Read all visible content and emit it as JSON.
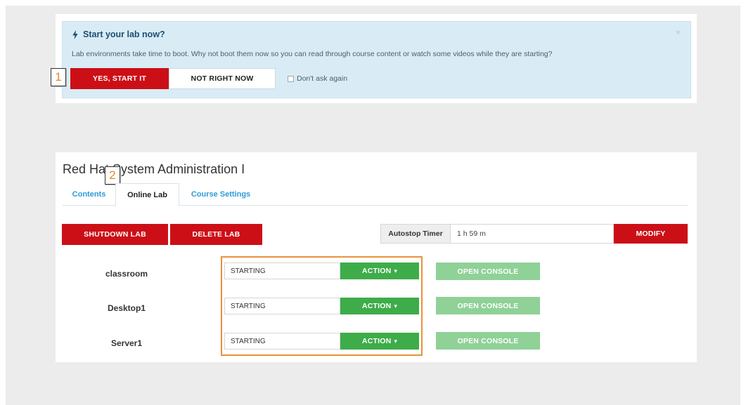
{
  "notice": {
    "title": "Start your lab now?",
    "close_symbol": "×",
    "message": "Lab environments take time to boot. Why not boot them now so you can read through course content or watch some videos while they are starting?",
    "yes_label": "YES, START IT",
    "no_label": "NOT RIGHT NOW",
    "dont_ask_label": "Don't ask again",
    "dont_ask_checked": false
  },
  "callouts": {
    "first": "1",
    "second": "2"
  },
  "lab": {
    "title": "Red Hat System Administration I",
    "tabs": [
      {
        "label": "Contents",
        "active": false
      },
      {
        "label": "Online Lab",
        "active": true
      },
      {
        "label": "Course Settings",
        "active": false
      }
    ],
    "shutdown_label": "SHUTDOWN LAB",
    "delete_label": "DELETE LAB",
    "autostop_label": "Autostop Timer",
    "autostop_value": "1 h 59 m",
    "modify_label": "MODIFY",
    "machines": [
      {
        "name": "classroom",
        "status": "STARTING",
        "action_label": "ACTION",
        "console_label": "OPEN CONSOLE"
      },
      {
        "name": "Desktop1",
        "status": "STARTING",
        "action_label": "ACTION",
        "console_label": "OPEN CONSOLE"
      },
      {
        "name": "Server1",
        "status": "STARTING",
        "action_label": "ACTION",
        "console_label": "OPEN CONSOLE"
      }
    ]
  },
  "colors": {
    "primary_red": "#cc0f17",
    "action_green": "#3eac49",
    "console_green_disabled": "#8fd197",
    "notice_blue": "#d9ecf5",
    "tab_link_blue": "#2e9bd6",
    "highlight_orange": "#e8923a"
  },
  "icons": {
    "notice_title_icon": "bolt-icon",
    "caret_icon": "caret-down-icon"
  }
}
